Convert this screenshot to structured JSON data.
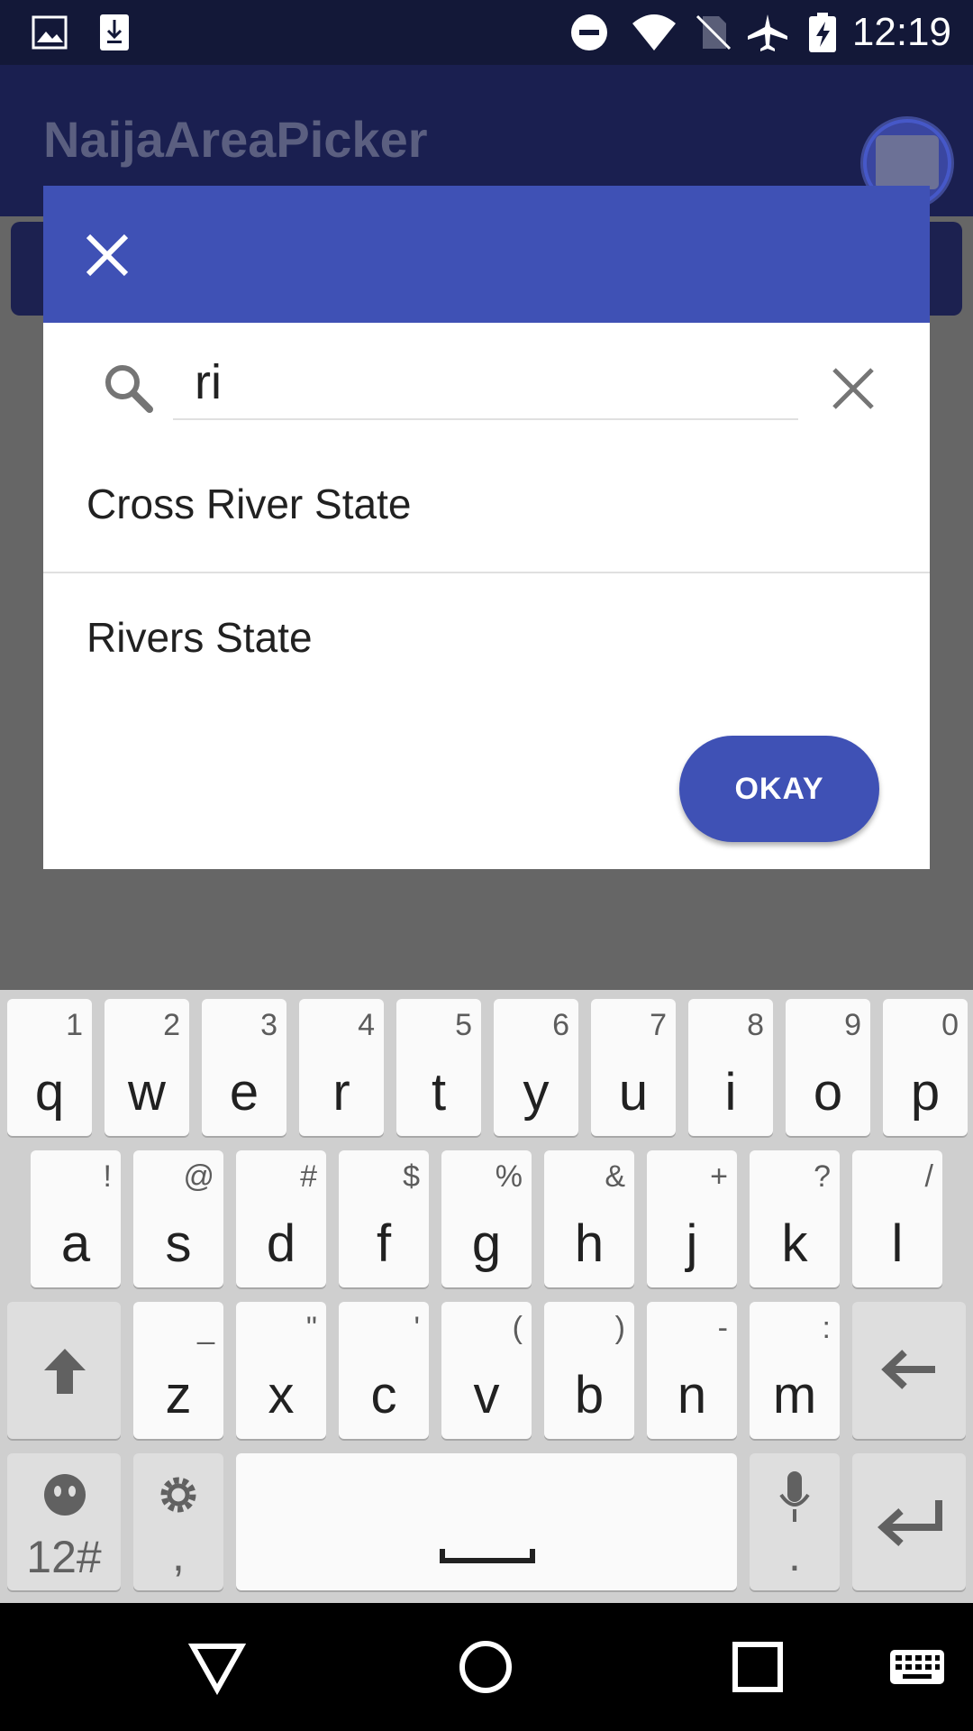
{
  "status_bar": {
    "time": "12:19",
    "icons": [
      "image-icon",
      "download-icon",
      "do-not-disturb-icon",
      "wifi-icon",
      "no-sim-icon",
      "airplane-mode-icon",
      "battery-charging-icon"
    ]
  },
  "app_bar": {
    "title": "NaijaAreaPicker"
  },
  "dialog": {
    "search_value": "ri",
    "results": [
      "Cross River State",
      "Rivers State"
    ],
    "okay_label": "OKAY"
  },
  "keyboard": {
    "row1": [
      {
        "k": "q",
        "h": "1"
      },
      {
        "k": "w",
        "h": "2"
      },
      {
        "k": "e",
        "h": "3"
      },
      {
        "k": "r",
        "h": "4"
      },
      {
        "k": "t",
        "h": "5"
      },
      {
        "k": "y",
        "h": "6"
      },
      {
        "k": "u",
        "h": "7"
      },
      {
        "k": "i",
        "h": "8"
      },
      {
        "k": "o",
        "h": "9"
      },
      {
        "k": "p",
        "h": "0"
      }
    ],
    "row2": [
      {
        "k": "a",
        "h": "!"
      },
      {
        "k": "s",
        "h": "@"
      },
      {
        "k": "d",
        "h": "#"
      },
      {
        "k": "f",
        "h": "$"
      },
      {
        "k": "g",
        "h": "%"
      },
      {
        "k": "h",
        "h": "&"
      },
      {
        "k": "j",
        "h": "+"
      },
      {
        "k": "k",
        "h": "?"
      },
      {
        "k": "l",
        "h": "/"
      }
    ],
    "row3": [
      {
        "k": "z",
        "h": "_"
      },
      {
        "k": "x",
        "h": "\""
      },
      {
        "k": "c",
        "h": "'"
      },
      {
        "k": "v",
        "h": "("
      },
      {
        "k": "b",
        "h": ")"
      },
      {
        "k": "n",
        "h": "-"
      },
      {
        "k": "m",
        "h": ":"
      }
    ],
    "symbols_label": "12#",
    "comma_label": ",",
    "period_label": "."
  },
  "colors": {
    "accent": "#3f51b5",
    "status_bar": "#131838",
    "scrim": "#666666"
  }
}
